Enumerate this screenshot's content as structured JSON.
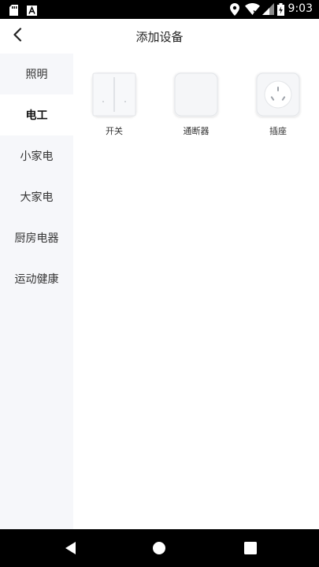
{
  "status_bar": {
    "time": "9:03",
    "icons": [
      "sd-card-icon",
      "a-notification-icon",
      "location-icon",
      "wifi-icon",
      "signal-icon",
      "battery-charging-icon"
    ]
  },
  "header": {
    "title": "添加设备",
    "back_icon": "chevron-left-icon"
  },
  "sidebar": {
    "items": [
      {
        "label": "照明",
        "active": false
      },
      {
        "label": "电工",
        "active": true
      },
      {
        "label": "小家电",
        "active": false
      },
      {
        "label": "大家电",
        "active": false
      },
      {
        "label": "厨房电器",
        "active": false
      },
      {
        "label": "运动健康",
        "active": false
      }
    ]
  },
  "devices": [
    {
      "label": "开关",
      "icon": "wall-switch-icon"
    },
    {
      "label": "通断器",
      "icon": "breaker-icon"
    },
    {
      "label": "插座",
      "icon": "outlet-icon"
    }
  ],
  "nav_bar": {
    "icons": [
      "back-triangle-icon",
      "home-circle-icon",
      "recents-square-icon"
    ]
  },
  "colors": {
    "sidebar_bg": "#f6f7fa",
    "status_bar_bg": "#000000",
    "tile_bg": "#f3f4f6"
  }
}
